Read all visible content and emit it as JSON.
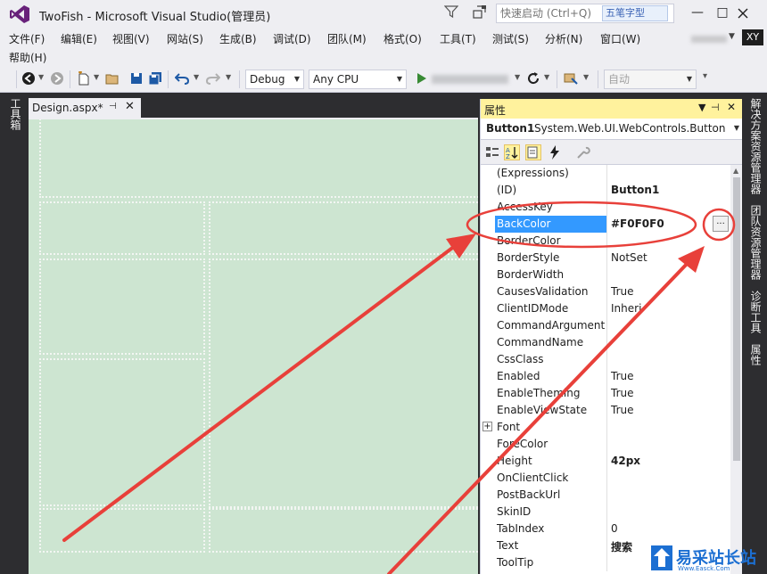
{
  "window": {
    "title": "TwoFish - Microsoft Visual Studio(管理员)",
    "quick_launch_placeholder": "快速启动 (Ctrl+Q)",
    "ime_label": "五笔字型",
    "minimize": "—",
    "maximize": "□",
    "account_initials": "XY",
    "logo_color": "#68217a"
  },
  "menu": {
    "items": [
      "文件(F)",
      "编辑(E)",
      "视图(V)",
      "网站(S)",
      "生成(B)",
      "调试(D)",
      "团队(M)",
      "格式(O)",
      "工具(T)",
      "测试(S)",
      "分析(N)",
      "窗口(W)"
    ],
    "help": "帮助(H)"
  },
  "toolbar": {
    "config": "Debug",
    "platform": "Any CPU",
    "auto": "自动"
  },
  "left_panel": {
    "toolbox": "工具箱"
  },
  "document": {
    "tab_label": "Design.aspx*",
    "pin": "⊣",
    "close": "✕"
  },
  "properties": {
    "header": "属性",
    "object_name": "Button1",
    "object_type": "System.Web.UI.WebControls.Button",
    "ellipsis": "...",
    "rows": [
      {
        "name": "(Expressions)",
        "value": "",
        "bold": false
      },
      {
        "name": "(ID)",
        "value": "Button1",
        "bold": true
      },
      {
        "name": "AccessKey",
        "value": "",
        "bold": false
      },
      {
        "name": "BackColor",
        "value": "#F0F0F0",
        "bold": true,
        "selected": true
      },
      {
        "name": "BorderColor",
        "value": "",
        "bold": false
      },
      {
        "name": "BorderStyle",
        "value": "NotSet",
        "bold": false
      },
      {
        "name": "BorderWidth",
        "value": "",
        "bold": false
      },
      {
        "name": "CausesValidation",
        "value": "True",
        "bold": false
      },
      {
        "name": "ClientIDMode",
        "value": "Inheri",
        "bold": false
      },
      {
        "name": "CommandArgument",
        "value": "",
        "bold": false
      },
      {
        "name": "CommandName",
        "value": "",
        "bold": false
      },
      {
        "name": "CssClass",
        "value": "",
        "bold": false
      },
      {
        "name": "Enabled",
        "value": "True",
        "bold": false
      },
      {
        "name": "EnableTheming",
        "value": "True",
        "bold": false
      },
      {
        "name": "EnableViewState",
        "value": "True",
        "bold": false
      },
      {
        "name": "Font",
        "value": "",
        "bold": false,
        "expandable": true
      },
      {
        "name": "ForeColor",
        "value": "",
        "bold": false
      },
      {
        "name": "Height",
        "value": "42px",
        "bold": true
      },
      {
        "name": "OnClientClick",
        "value": "",
        "bold": false
      },
      {
        "name": "PostBackUrl",
        "value": "",
        "bold": false
      },
      {
        "name": "SkinID",
        "value": "",
        "bold": false
      },
      {
        "name": "TabIndex",
        "value": "0",
        "bold": false
      },
      {
        "name": "Text",
        "value": "搜索",
        "bold": true
      },
      {
        "name": "ToolTip",
        "value": "",
        "bold": false
      }
    ]
  },
  "right_panel": {
    "tabs": [
      "解决方案资源管理器",
      "团队资源管理器",
      "诊断工具",
      "属性"
    ]
  },
  "watermark": {
    "text": "易采站长站",
    "sub": "Www.Easck.Com"
  },
  "colors": {
    "designer_bg": "#cde5d1",
    "header_yellow": "#fff29d",
    "annotation_red": "#e8403a",
    "selection_blue": "#3399ff"
  }
}
